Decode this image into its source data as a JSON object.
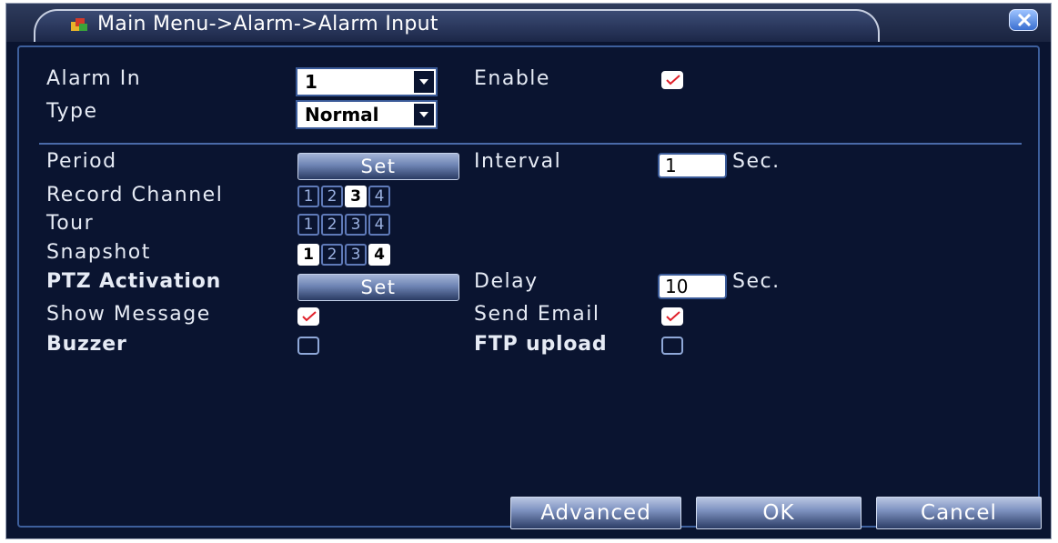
{
  "window": {
    "title": "Main Menu->Alarm->Alarm Input"
  },
  "form": {
    "alarm_in_label": "Alarm In",
    "alarm_in_value": "1",
    "enable_label": "Enable",
    "enable_checked": true,
    "type_label": "Type",
    "type_value": "Normal",
    "period_label": "Period",
    "period_button": "Set",
    "interval_label": "Interval",
    "interval_value": "1",
    "interval_unit": "Sec.",
    "record_channel_label": "Record Channel",
    "record_channel": [
      {
        "label": "1",
        "selected": false
      },
      {
        "label": "2",
        "selected": false
      },
      {
        "label": "3",
        "selected": true
      },
      {
        "label": "4",
        "selected": false
      }
    ],
    "tour_label": "Tour",
    "tour": [
      {
        "label": "1",
        "selected": false
      },
      {
        "label": "2",
        "selected": false
      },
      {
        "label": "3",
        "selected": false
      },
      {
        "label": "4",
        "selected": false
      }
    ],
    "snapshot_label": "Snapshot",
    "snapshot": [
      {
        "label": "1",
        "selected": true
      },
      {
        "label": "2",
        "selected": false
      },
      {
        "label": "3",
        "selected": false
      },
      {
        "label": "4",
        "selected": true
      }
    ],
    "ptz_label": "PTZ Activation",
    "ptz_button": "Set",
    "delay_label": "Delay",
    "delay_value": "10",
    "delay_unit": "Sec.",
    "show_message_label": "Show Message",
    "show_message_checked": true,
    "send_email_label": "Send Email",
    "send_email_checked": true,
    "buzzer_label": "Buzzer",
    "buzzer_checked": false,
    "ftp_upload_label": "FTP upload",
    "ftp_upload_checked": false
  },
  "buttons": {
    "advanced": "Advanced",
    "ok": "OK",
    "cancel": "Cancel"
  },
  "colors": {
    "background": "#0a1430",
    "border": "#3d5f9c",
    "check_mark": "#e0202a"
  }
}
